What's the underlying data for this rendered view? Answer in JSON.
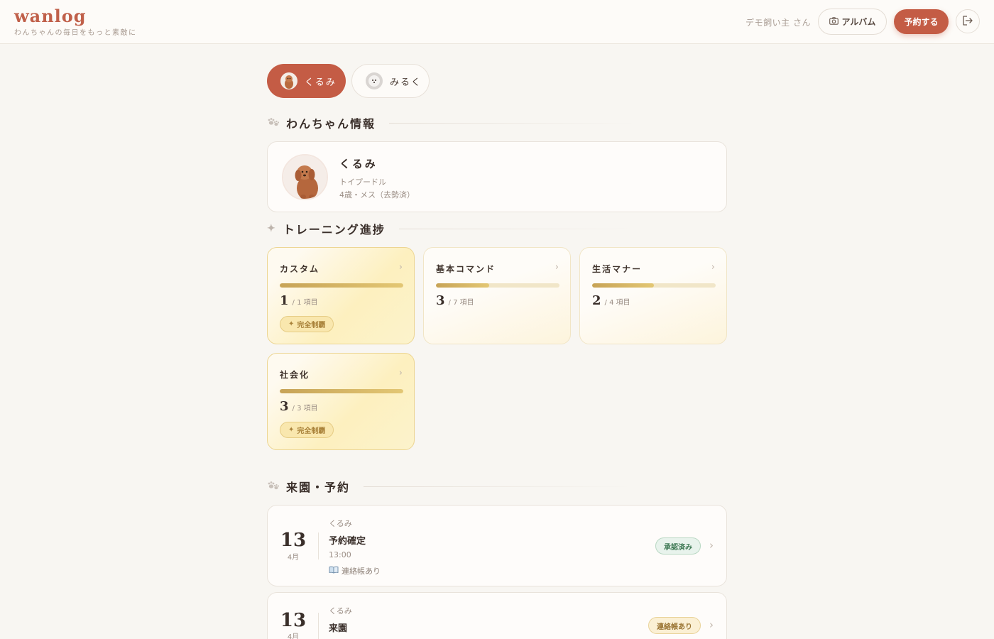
{
  "header": {
    "logo": "wanlog",
    "tagline": "わんちゃんの毎日をもっと素敵に",
    "owner": "デモ飼い主 さん",
    "album_label": "アルバム",
    "reserve_label": "予約する"
  },
  "dog_tabs": [
    {
      "name": "くるみ",
      "active": true
    },
    {
      "name": "みるく",
      "active": false
    }
  ],
  "sections": {
    "dog_info": "わんちゃん情報",
    "training": "トレーニング進捗",
    "visits": "来園・予約"
  },
  "profile": {
    "name": "くるみ",
    "breed": "トイプードル",
    "age": "4歳・メス（去勢済）"
  },
  "training": [
    {
      "title": "カスタム",
      "done": 1,
      "total": "/ 1 項目",
      "progress": 1.0,
      "badge": "完全制覇"
    },
    {
      "title": "基本コマンド",
      "done": 3,
      "total": "/ 7 項目",
      "progress": 0.43,
      "badge": null
    },
    {
      "title": "生活マナー",
      "done": 2,
      "total": "/ 4 項目",
      "progress": 0.5,
      "badge": null
    },
    {
      "title": "社会化",
      "done": 3,
      "total": "/ 3 項目",
      "progress": 1.0,
      "badge": "完全制覇"
    }
  ],
  "visits": [
    {
      "day": "13",
      "month": "4月",
      "dog": "くるみ",
      "title": "予約確定",
      "time": "13:00",
      "note": "連絡帳あり",
      "status": "承認済み"
    },
    {
      "day": "13",
      "month": "4月",
      "dog": "くるみ",
      "title": "来園",
      "status": "連絡帳あり"
    }
  ],
  "colors": {
    "accent": "#c45c45",
    "gold": "#c7a356",
    "background": "#f8f6f2"
  }
}
